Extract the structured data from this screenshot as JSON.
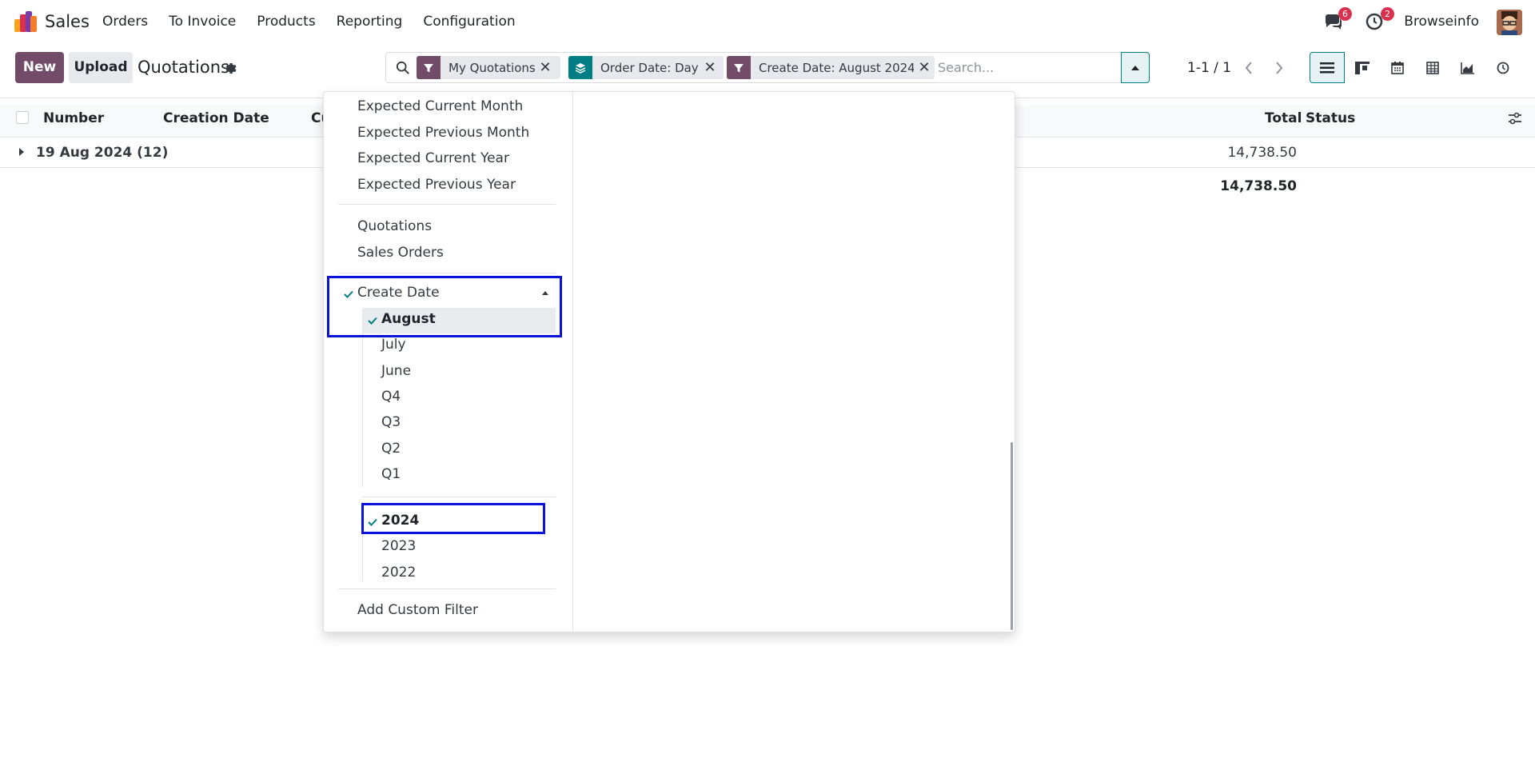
{
  "navbar": {
    "app_name": "Sales",
    "menu": [
      "Orders",
      "To Invoice",
      "Products",
      "Reporting",
      "Configuration"
    ],
    "messages_badge": "6",
    "activities_badge": "2",
    "user_name": "Browseinfo",
    "icons": [
      "sales-app-logo",
      "chat-icon",
      "clock-icon",
      "avatar"
    ]
  },
  "control": {
    "new_label": "New",
    "upload_label": "Upload",
    "title": "Quotations",
    "search_placeholder": "Search...",
    "facets": [
      {
        "label": "My Quotations",
        "type": "filter"
      },
      {
        "label": "Order Date: Day",
        "type": "group-by"
      },
      {
        "label": "Create Date: August 2024",
        "type": "filter"
      }
    ],
    "pager": "1-1 / 1",
    "views": [
      "list",
      "kanban",
      "calendar",
      "pivot",
      "graph",
      "activity"
    ]
  },
  "list": {
    "columns": [
      "Number",
      "Creation Date",
      "Cu",
      "Total",
      "Status"
    ],
    "group_label": "19 Aug 2024 (12)",
    "group_total": "14,738.50",
    "grand_total": "14,738.50"
  },
  "dropdown": {
    "expected_items": [
      "Expected Current Month",
      "Expected Previous Month",
      "Expected Current Year",
      "Expected Previous Year"
    ],
    "state_items": [
      "Quotations",
      "Sales Orders"
    ],
    "create_date_label": "Create Date",
    "months": [
      "August",
      "July",
      "June"
    ],
    "quarters": [
      "Q4",
      "Q3",
      "Q2",
      "Q1"
    ],
    "years": [
      "2024",
      "2023",
      "2022"
    ],
    "add_custom_filter": "Add Custom Filter",
    "selected_month": "August",
    "selected_year": "2024"
  },
  "colors": {
    "brand": "#714b67",
    "teal": "#017e84",
    "highlight_box": "#0a13d9",
    "badge": "#d9324f"
  }
}
